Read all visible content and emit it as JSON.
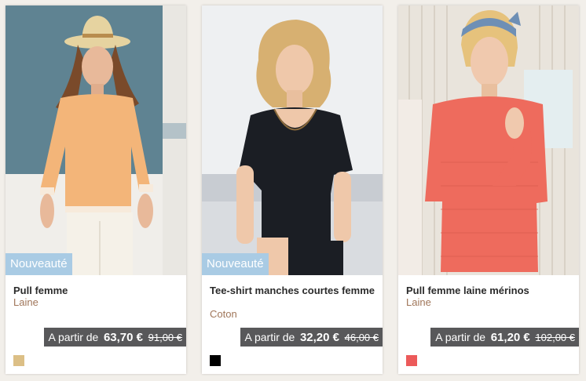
{
  "products": [
    {
      "badge": "Nouveauté",
      "title": "Pull femme",
      "material": "Laine",
      "price_prefix": "A partir de",
      "price": "63,70 €",
      "old_price": "91,00 €",
      "swatch_color": "#dcbf86",
      "image_colors": {
        "background": "#5f8392",
        "garment": "#f3b579",
        "skin": "#e8b99a",
        "hair": "#7a4a2a",
        "hat": "#e6d3a0",
        "pants": "#f5f1e8"
      }
    },
    {
      "badge": "Nouveauté",
      "title": "Tee-shirt manches courtes femme",
      "material": "Coton",
      "price_prefix": "A partir de",
      "price": "32,20 €",
      "old_price": "46,00 €",
      "swatch_color": "#000000",
      "image_colors": {
        "background": "#eef0f2",
        "garment": "#1b1e24",
        "skin": "#efc8aa",
        "hair": "#d7b071",
        "sofa": "#c8ccd2"
      }
    },
    {
      "badge": "",
      "title": "Pull femme laine mérinos",
      "material": "Laine",
      "price_prefix": "A partir de",
      "price": "61,20 €",
      "old_price": "102,00 €",
      "swatch_color": "#ec5a5a",
      "image_colors": {
        "background": "#e9e4dc",
        "garment": "#ee6b5d",
        "skin": "#f0c9ae",
        "hair": "#e6c27c",
        "headband": "#6e8fb5"
      }
    }
  ]
}
